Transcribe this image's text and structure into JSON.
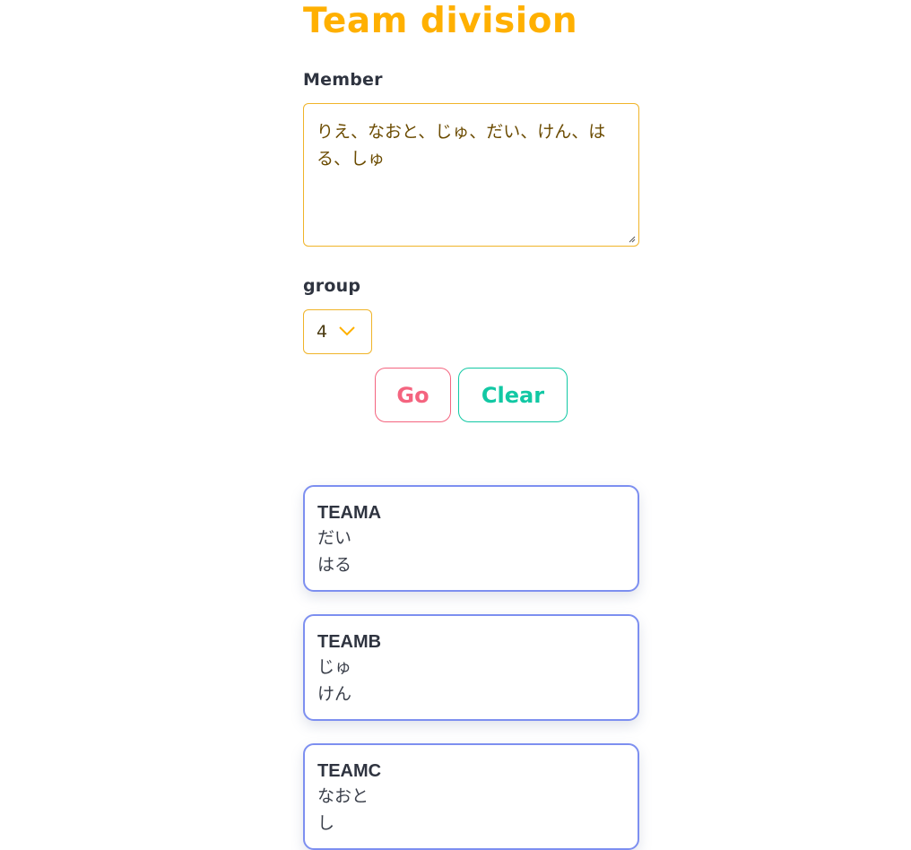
{
  "page": {
    "title": "Team division"
  },
  "member": {
    "label": "Member",
    "value": "りえ、なおと、じゅ、だい、けん、はる、しゅ"
  },
  "group": {
    "label": "group",
    "selected": "4"
  },
  "buttons": {
    "go": "Go",
    "clear": "Clear"
  },
  "colors": {
    "title": "#ffb000",
    "input_border": "#f0b429",
    "go": "#f4647f",
    "clear": "#12c8a4",
    "card_border": "#7d8ff0"
  },
  "teams": [
    {
      "name": "TEAMA",
      "members": [
        "だい",
        "はる"
      ]
    },
    {
      "name": "TEAMB",
      "members": [
        "じゅ",
        "けん"
      ]
    },
    {
      "name": "TEAMC",
      "members": [
        "なおと",
        "し"
      ]
    }
  ]
}
